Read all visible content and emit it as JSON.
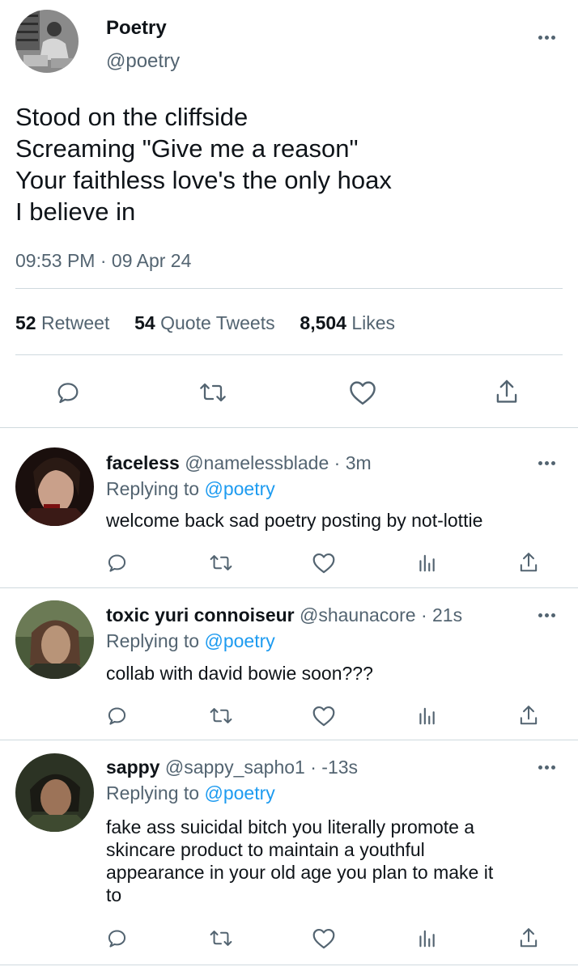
{
  "main_tweet": {
    "author_name": "Poetry",
    "author_handle": "@poetry",
    "text_lines": [
      "Stood on the cliffside",
      "Screaming \"Give me a reason\"",
      "Your faithless love's the only hoax",
      "I believe in"
    ],
    "time": "09:53 PM",
    "separator": "·",
    "date": "09 Apr 24",
    "stats": {
      "retweets_count": "52",
      "retweets_label": "Retweet",
      "quotes_count": "54",
      "quotes_label": "Quote Tweets",
      "likes_count": "8,504",
      "likes_label": "Likes"
    }
  },
  "replies": [
    {
      "name": "faceless",
      "handle": "@namelessblade",
      "time": "· 3m",
      "replying_prefix": "Replying to",
      "replying_to": "@poetry",
      "text_lines": [
        "welcome back sad poetry posting by not-lottie"
      ]
    },
    {
      "name": "toxic yuri connoiseur",
      "handle": "@shaunacore",
      "time": "· 21s",
      "replying_prefix": "Replying to",
      "replying_to": "@poetry",
      "text_lines": [
        "collab with david bowie soon???"
      ]
    },
    {
      "name": "sappy",
      "handle": "@sappy_sapho1",
      "time": "· -13s",
      "replying_prefix": "Replying to",
      "replying_to": "@poetry",
      "text_lines": [
        "fake ass suicidal bitch you literally promote a",
        "skincare product to maintain a youthful",
        "appearance in your old age you plan to make it",
        "to"
      ]
    }
  ],
  "icons": [
    "reply-icon",
    "retweet-icon",
    "like-icon",
    "views-icon",
    "share-icon",
    "more-icon"
  ],
  "colors": {
    "text": "#0f1419",
    "secondary": "#536471",
    "link": "#1d9bf0",
    "divider": "#cfd9de"
  }
}
